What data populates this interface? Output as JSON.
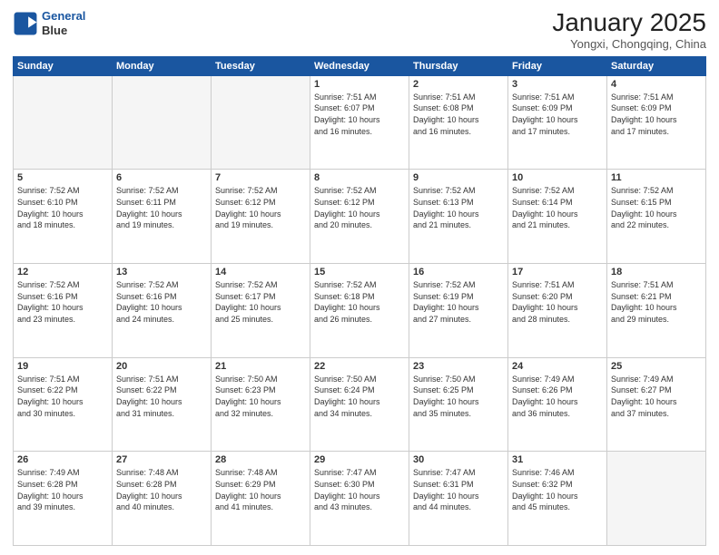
{
  "header": {
    "logo_line1": "General",
    "logo_line2": "Blue",
    "title": "January 2025",
    "subtitle": "Yongxi, Chongqing, China"
  },
  "weekdays": [
    "Sunday",
    "Monday",
    "Tuesday",
    "Wednesday",
    "Thursday",
    "Friday",
    "Saturday"
  ],
  "weeks": [
    [
      {
        "day": "",
        "info": ""
      },
      {
        "day": "",
        "info": ""
      },
      {
        "day": "",
        "info": ""
      },
      {
        "day": "1",
        "info": "Sunrise: 7:51 AM\nSunset: 6:07 PM\nDaylight: 10 hours\nand 16 minutes."
      },
      {
        "day": "2",
        "info": "Sunrise: 7:51 AM\nSunset: 6:08 PM\nDaylight: 10 hours\nand 16 minutes."
      },
      {
        "day": "3",
        "info": "Sunrise: 7:51 AM\nSunset: 6:09 PM\nDaylight: 10 hours\nand 17 minutes."
      },
      {
        "day": "4",
        "info": "Sunrise: 7:51 AM\nSunset: 6:09 PM\nDaylight: 10 hours\nand 17 minutes."
      }
    ],
    [
      {
        "day": "5",
        "info": "Sunrise: 7:52 AM\nSunset: 6:10 PM\nDaylight: 10 hours\nand 18 minutes."
      },
      {
        "day": "6",
        "info": "Sunrise: 7:52 AM\nSunset: 6:11 PM\nDaylight: 10 hours\nand 19 minutes."
      },
      {
        "day": "7",
        "info": "Sunrise: 7:52 AM\nSunset: 6:12 PM\nDaylight: 10 hours\nand 19 minutes."
      },
      {
        "day": "8",
        "info": "Sunrise: 7:52 AM\nSunset: 6:12 PM\nDaylight: 10 hours\nand 20 minutes."
      },
      {
        "day": "9",
        "info": "Sunrise: 7:52 AM\nSunset: 6:13 PM\nDaylight: 10 hours\nand 21 minutes."
      },
      {
        "day": "10",
        "info": "Sunrise: 7:52 AM\nSunset: 6:14 PM\nDaylight: 10 hours\nand 21 minutes."
      },
      {
        "day": "11",
        "info": "Sunrise: 7:52 AM\nSunset: 6:15 PM\nDaylight: 10 hours\nand 22 minutes."
      }
    ],
    [
      {
        "day": "12",
        "info": "Sunrise: 7:52 AM\nSunset: 6:16 PM\nDaylight: 10 hours\nand 23 minutes."
      },
      {
        "day": "13",
        "info": "Sunrise: 7:52 AM\nSunset: 6:16 PM\nDaylight: 10 hours\nand 24 minutes."
      },
      {
        "day": "14",
        "info": "Sunrise: 7:52 AM\nSunset: 6:17 PM\nDaylight: 10 hours\nand 25 minutes."
      },
      {
        "day": "15",
        "info": "Sunrise: 7:52 AM\nSunset: 6:18 PM\nDaylight: 10 hours\nand 26 minutes."
      },
      {
        "day": "16",
        "info": "Sunrise: 7:52 AM\nSunset: 6:19 PM\nDaylight: 10 hours\nand 27 minutes."
      },
      {
        "day": "17",
        "info": "Sunrise: 7:51 AM\nSunset: 6:20 PM\nDaylight: 10 hours\nand 28 minutes."
      },
      {
        "day": "18",
        "info": "Sunrise: 7:51 AM\nSunset: 6:21 PM\nDaylight: 10 hours\nand 29 minutes."
      }
    ],
    [
      {
        "day": "19",
        "info": "Sunrise: 7:51 AM\nSunset: 6:22 PM\nDaylight: 10 hours\nand 30 minutes."
      },
      {
        "day": "20",
        "info": "Sunrise: 7:51 AM\nSunset: 6:22 PM\nDaylight: 10 hours\nand 31 minutes."
      },
      {
        "day": "21",
        "info": "Sunrise: 7:50 AM\nSunset: 6:23 PM\nDaylight: 10 hours\nand 32 minutes."
      },
      {
        "day": "22",
        "info": "Sunrise: 7:50 AM\nSunset: 6:24 PM\nDaylight: 10 hours\nand 34 minutes."
      },
      {
        "day": "23",
        "info": "Sunrise: 7:50 AM\nSunset: 6:25 PM\nDaylight: 10 hours\nand 35 minutes."
      },
      {
        "day": "24",
        "info": "Sunrise: 7:49 AM\nSunset: 6:26 PM\nDaylight: 10 hours\nand 36 minutes."
      },
      {
        "day": "25",
        "info": "Sunrise: 7:49 AM\nSunset: 6:27 PM\nDaylight: 10 hours\nand 37 minutes."
      }
    ],
    [
      {
        "day": "26",
        "info": "Sunrise: 7:49 AM\nSunset: 6:28 PM\nDaylight: 10 hours\nand 39 minutes."
      },
      {
        "day": "27",
        "info": "Sunrise: 7:48 AM\nSunset: 6:28 PM\nDaylight: 10 hours\nand 40 minutes."
      },
      {
        "day": "28",
        "info": "Sunrise: 7:48 AM\nSunset: 6:29 PM\nDaylight: 10 hours\nand 41 minutes."
      },
      {
        "day": "29",
        "info": "Sunrise: 7:47 AM\nSunset: 6:30 PM\nDaylight: 10 hours\nand 43 minutes."
      },
      {
        "day": "30",
        "info": "Sunrise: 7:47 AM\nSunset: 6:31 PM\nDaylight: 10 hours\nand 44 minutes."
      },
      {
        "day": "31",
        "info": "Sunrise: 7:46 AM\nSunset: 6:32 PM\nDaylight: 10 hours\nand 45 minutes."
      },
      {
        "day": "",
        "info": ""
      }
    ]
  ]
}
